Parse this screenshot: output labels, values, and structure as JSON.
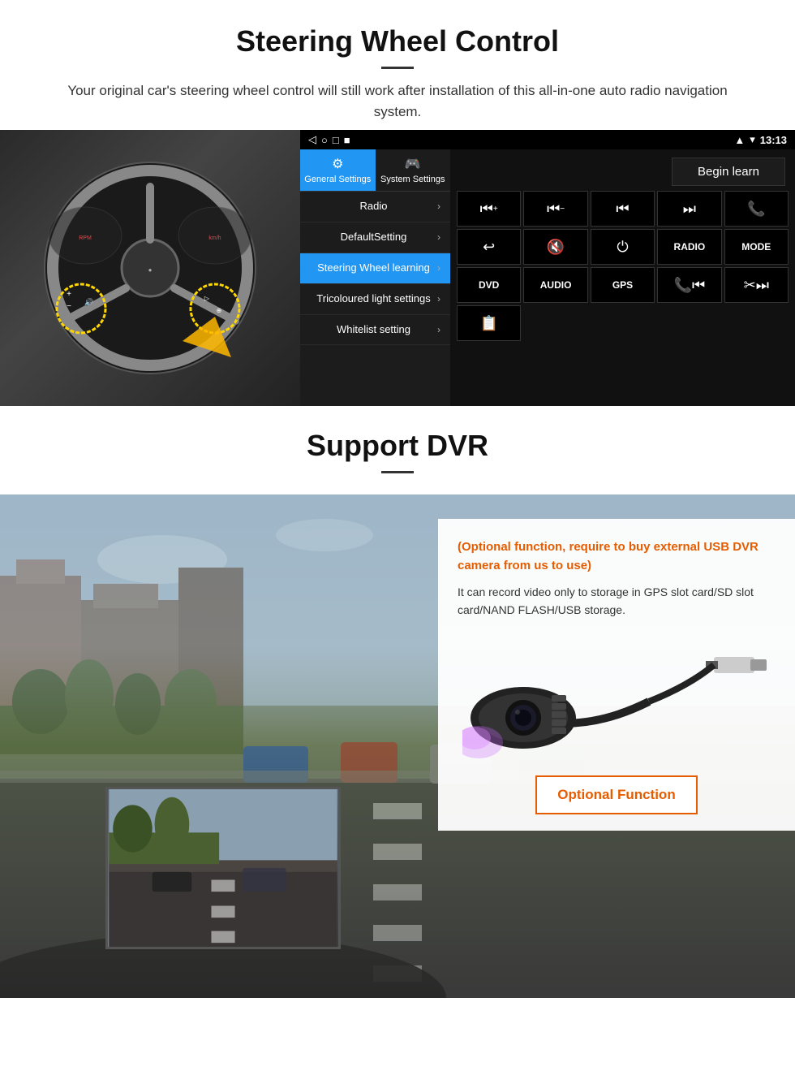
{
  "steering_section": {
    "title": "Steering Wheel Control",
    "subtitle": "Your original car's steering wheel control will still work after installation of this all-in-one auto radio navigation system.",
    "statusbar": {
      "time": "13:13",
      "icons": [
        "◁",
        "○",
        "□",
        "■"
      ]
    },
    "tabs": [
      {
        "icon": "⚙",
        "label": "General Settings",
        "active": true
      },
      {
        "icon": "🎮",
        "label": "System Settings",
        "active": false
      }
    ],
    "menu_items": [
      {
        "label": "Radio",
        "active": false
      },
      {
        "label": "DefaultSetting",
        "active": false
      },
      {
        "label": "Steering Wheel learning",
        "active": true
      },
      {
        "label": "Tricoloured light settings",
        "active": false
      },
      {
        "label": "Whitelist setting",
        "active": false
      }
    ],
    "begin_learn_label": "Begin learn",
    "control_buttons": [
      {
        "symbol": "⏮+",
        "type": "icon"
      },
      {
        "symbol": "⏮−",
        "type": "icon"
      },
      {
        "symbol": "⏮",
        "type": "icon"
      },
      {
        "symbol": "⏭",
        "type": "icon"
      },
      {
        "symbol": "📞",
        "type": "icon"
      },
      {
        "symbol": "↩",
        "type": "icon"
      },
      {
        "symbol": "🔇×",
        "type": "icon"
      },
      {
        "symbol": "⏻",
        "type": "icon"
      },
      {
        "label": "RADIO",
        "type": "text"
      },
      {
        "label": "MODE",
        "type": "text"
      },
      {
        "label": "DVD",
        "type": "text"
      },
      {
        "label": "AUDIO",
        "type": "text"
      },
      {
        "label": "GPS",
        "type": "text"
      },
      {
        "symbol": "📞⏮",
        "type": "icon"
      },
      {
        "symbol": "✂⏭",
        "type": "icon"
      },
      {
        "symbol": "📋",
        "type": "icon"
      }
    ]
  },
  "dvr_section": {
    "title": "Support DVR",
    "optional_text": "(Optional function, require to buy external USB DVR camera from us to use)",
    "desc_text": "It can record video only to storage in GPS slot card/SD slot card/NAND FLASH/USB storage.",
    "optional_function_label": "Optional Function"
  }
}
